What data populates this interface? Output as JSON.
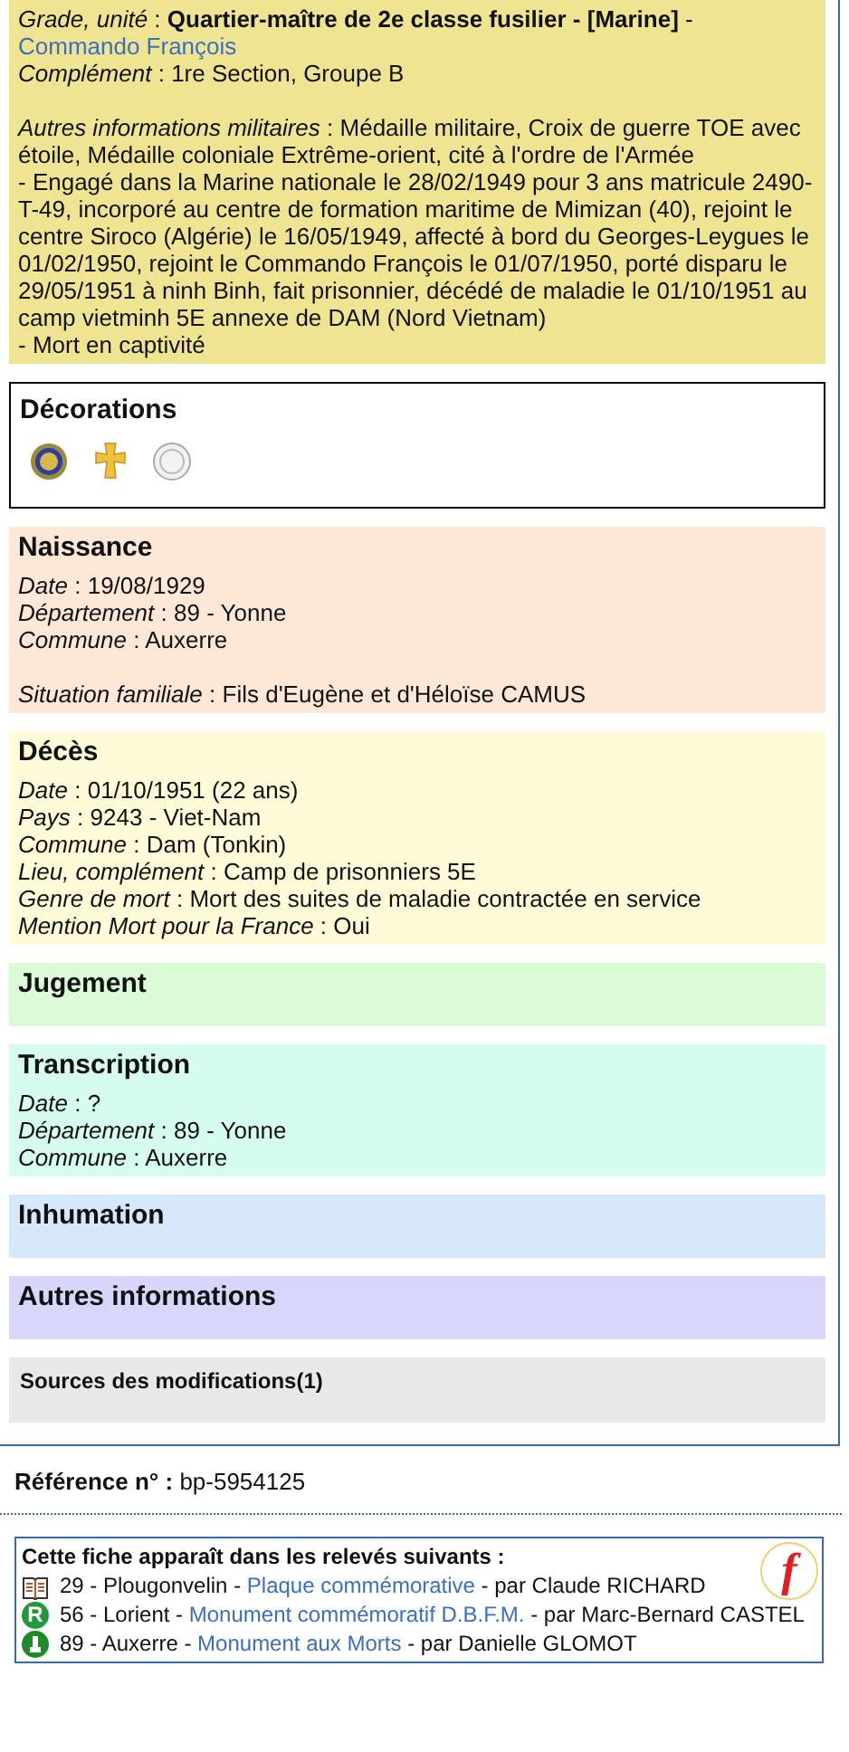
{
  "sections": [
    {
      "kind": "fields",
      "color": "#efe491",
      "groups": [
        [
          {
            "label": "Grade, unité",
            "sep": ":",
            "parts": [
              {
                "kind": "bold",
                "text": "Quartier-maître de 2e classe fusilier - [Marine]"
              },
              {
                "kind": "plain",
                "text": " - "
              },
              {
                "kind": "link",
                "text": "Commando François"
              }
            ]
          },
          {
            "label": "Complément",
            "sep": ":",
            "parts": [
              {
                "kind": "plain",
                "text": "1re Section, Groupe B"
              }
            ]
          }
        ],
        [
          {
            "label": "Autres informations militaires",
            "sep": ":",
            "parts": [
              {
                "kind": "plain",
                "text": "Médaille militaire, Croix de guerre TOE avec étoile, Médaille coloniale Extrême-orient, cité à l'ordre de l'Armée\n- Engagé dans la Marine nationale le 28/02/1949 pour 3 ans matricule 2490-T-49, incorporé au centre de formation maritime de Mimizan (40), rejoint le centre Siroco (Algérie) le 16/05/1949, affecté à bord du Georges-Leygues le 01/02/1950, rejoint le Commando François le 01/07/1950, porté disparu le 29/05/1951 à ninh Binh, fait prisonnier, décédé de maladie le 01/10/1951 au camp vietminh 5E annexe de DAM (Nord Vietnam)\n- Mort en captivité"
              }
            ]
          }
        ]
      ]
    },
    {
      "kind": "medals",
      "title": "Décorations",
      "medals": [
        {
          "kind": "round"
        },
        {
          "kind": "cross"
        },
        {
          "kind": "silver"
        }
      ]
    },
    {
      "kind": "fields",
      "title": "Naissance",
      "color": "#fde8d8",
      "groups": [
        [
          {
            "label": "Date",
            "sep": ":",
            "parts": [
              {
                "kind": "plain",
                "text": "19/08/1929"
              }
            ]
          },
          {
            "label": "Département",
            "sep": ":",
            "parts": [
              {
                "kind": "plain",
                "text": "89 - Yonne"
              }
            ]
          },
          {
            "label": "Commune",
            "sep": ":",
            "parts": [
              {
                "kind": "plain",
                "text": "Auxerre"
              }
            ]
          }
        ],
        [
          {
            "label": "Situation familiale",
            "sep": ":",
            "parts": [
              {
                "kind": "plain",
                "text": "Fils d'Eugène et d'Héloïse CAMUS"
              }
            ]
          }
        ]
      ]
    },
    {
      "kind": "fields",
      "title": "Décès",
      "color": "#fffbd8",
      "groups": [
        [
          {
            "label": "Date",
            "sep": ":",
            "parts": [
              {
                "kind": "plain",
                "text": "01/10/1951  (22 ans)"
              }
            ]
          },
          {
            "label": "Pays",
            "sep": ":",
            "parts": [
              {
                "kind": "plain",
                "text": "9243 - Viet-Nam"
              }
            ]
          },
          {
            "label": "Commune",
            "sep": ":",
            "parts": [
              {
                "kind": "plain",
                "text": "Dam (Tonkin)"
              }
            ]
          },
          {
            "label": "Lieu, complément",
            "sep": ":",
            "parts": [
              {
                "kind": "plain",
                "text": "Camp de prisonniers 5E"
              }
            ]
          },
          {
            "label": "Genre de mort",
            "sep": ":",
            "parts": [
              {
                "kind": "plain",
                "text": "Mort des suites de maladie contractée en service"
              }
            ]
          },
          {
            "label": "Mention Mort pour la France",
            "sep": ":",
            "parts": [
              {
                "kind": "plain",
                "text": "Oui"
              }
            ]
          }
        ]
      ]
    },
    {
      "kind": "fields",
      "title": "Jugement",
      "color": "#dbfbd7"
    },
    {
      "kind": "fields",
      "title": "Transcription",
      "color": "#d5fcef",
      "groups": [
        [
          {
            "label": "Date",
            "sep": ":",
            "parts": [
              {
                "kind": "plain",
                "text": "?"
              }
            ]
          },
          {
            "label": "Département",
            "sep": ":",
            "parts": [
              {
                "kind": "plain",
                "text": "89 - Yonne"
              }
            ]
          },
          {
            "label": "Commune",
            "sep": ":",
            "parts": [
              {
                "kind": "plain",
                "text": "Auxerre"
              }
            ]
          }
        ]
      ]
    },
    {
      "kind": "fields",
      "title": "Inhumation",
      "color": "#d8e8fb"
    },
    {
      "kind": "fields",
      "title": "Autres informations",
      "color": "#d8d6fa"
    },
    {
      "kind": "small",
      "title": "Sources des modifications(1)",
      "color": "#e8e8e8"
    }
  ],
  "reference": {
    "label": "Référence n° :",
    "value": "bp-5954125"
  },
  "releves": {
    "title": "Cette fiche apparaît dans les relevés suivants :",
    "logo": "f",
    "items": [
      {
        "icon": {
          "kind": "book"
        },
        "place": "29 - Plougonvelin",
        "sep": " - ",
        "link": "Plaque commémorative",
        "author": " - par Claude RICHARD"
      },
      {
        "icon": {
          "kind": "letter",
          "letter": "R"
        },
        "place": "56 - Lorient",
        "sep": " - ",
        "link": "Monument commémoratif D.B.F.M.",
        "author": " - par Marc-Bernard CASTEL"
      },
      {
        "icon": {
          "kind": "monument"
        },
        "place": "89 - Auxerre",
        "sep": " - ",
        "link": "Monument aux Morts",
        "author": " - par Danielle GLOMOT"
      }
    ]
  }
}
